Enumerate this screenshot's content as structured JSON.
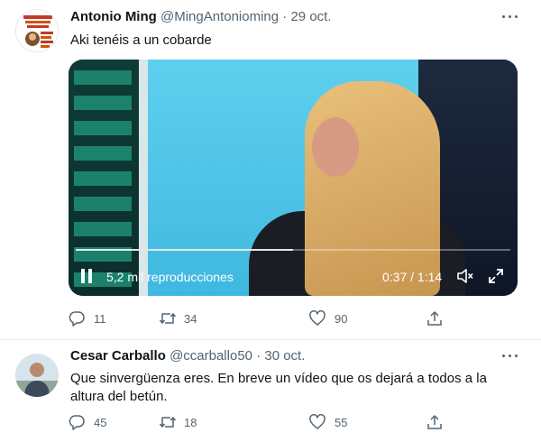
{
  "tweets": [
    {
      "display_name": "Antonio Ming",
      "handle": "@MingAntonioming",
      "separator": "·",
      "date": "29 oct.",
      "text": "Aki tenéis a un cobarde",
      "video": {
        "views": "5,2 mil reproducciones",
        "time": "0:37 / 1:14",
        "progress": 0.5
      },
      "stats": {
        "replies": "11",
        "retweets": "34",
        "likes": "90"
      }
    },
    {
      "display_name": "Cesar Carballo",
      "handle": "@ccarballo50",
      "separator": "·",
      "date": "30 oct.",
      "text": "Que sinvergüenza eres. En breve un vídeo que os dejará a todos a la altura del betún.",
      "stats": {
        "replies": "45",
        "retweets": "18",
        "likes": "55"
      }
    }
  ],
  "icons": {
    "reply": "reply-icon",
    "retweet": "retweet-icon",
    "like": "heart-icon",
    "share": "share-icon",
    "more": "more-icon",
    "pause": "pause-icon",
    "mute": "volume-muted-icon",
    "expand": "expand-icon"
  },
  "colors": {
    "text": "#0f1419",
    "secondary": "#536471",
    "divider": "#e6ecf0"
  }
}
